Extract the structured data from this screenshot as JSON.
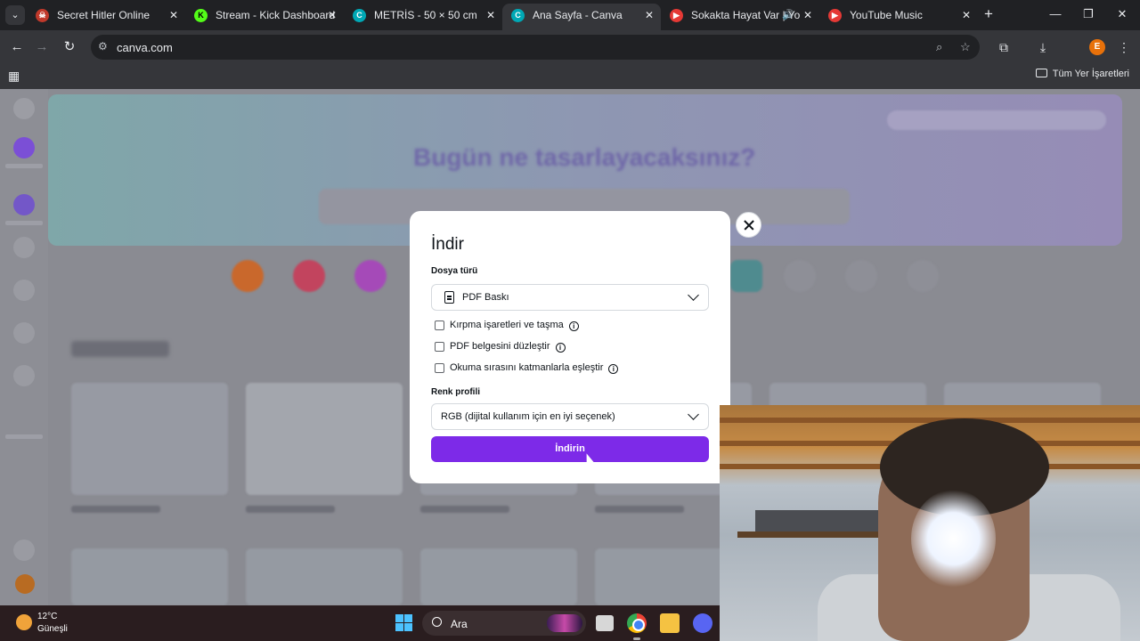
{
  "browser": {
    "tabs": [
      {
        "title": "Secret Hitler Online",
        "favicon_color": "#c0392b"
      },
      {
        "title": "Stream - Kick Dashboard",
        "favicon_color": "#53fc18"
      },
      {
        "title": "METRİS - 50 × 50 cm",
        "favicon_color": "#00c4cc"
      },
      {
        "title": "Ana Sayfa - Canva",
        "favicon_color": "#00c4cc"
      },
      {
        "title": "Sokakta Hayat Var | Yo",
        "favicon_color": "#ff0000"
      },
      {
        "title": "YouTube Music",
        "favicon_color": "#ff0000"
      }
    ],
    "active_tab_index": 3,
    "url": "canva.com",
    "profile_initial": "E",
    "bookmarks_folder": "Tüm Yer İşaretleri"
  },
  "dialog": {
    "title": "İndir",
    "file_type_label": "Dosya türü",
    "file_type_value": "PDF Baskı",
    "options": [
      {
        "label": "Kırpma işaretleri ve taşma",
        "checked": false
      },
      {
        "label": "PDF belgesini düzleştir",
        "checked": false
      },
      {
        "label": "Okuma sırasını katmanlarla eşleştir",
        "checked": false
      }
    ],
    "color_profile_label": "Renk profili",
    "color_profile_value": "RGB (dijital kullanım için en iyi seçenek)",
    "download_button": "İndirin"
  },
  "taskbar": {
    "temperature": "12°C",
    "weather": "Güneşli",
    "search_placeholder": "Ara"
  },
  "colors": {
    "accent": "#7d2ae8",
    "modal_bg": "#ffffff",
    "chrome_dark": "#202124",
    "taskbar_bg": "#2a1d1f"
  }
}
